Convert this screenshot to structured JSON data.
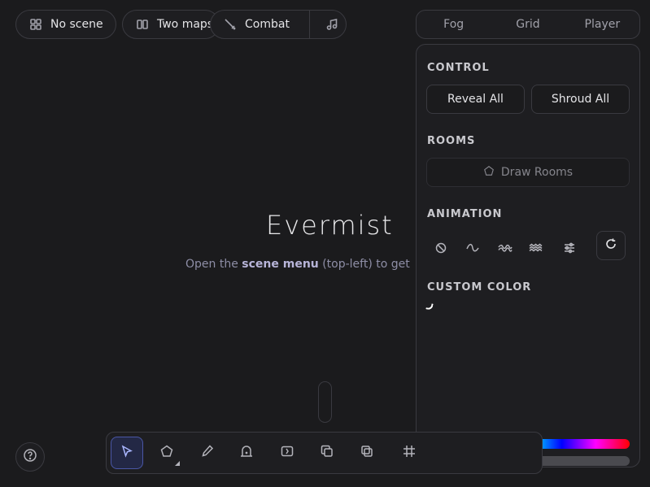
{
  "topbar": {
    "scene_label": "No scene",
    "maps_label": "Two maps",
    "combat_label": "Combat"
  },
  "tabs": [
    "Fog",
    "Grid",
    "Player"
  ],
  "panel": {
    "control_title": "CONTROL",
    "reveal_label": "Reveal All",
    "shroud_label": "Shroud All",
    "rooms_title": "ROOMS",
    "draw_rooms_label": "Draw Rooms",
    "animation_title": "ANIMATION",
    "custom_color_title": "CUSTOM COLOR"
  },
  "main": {
    "title": "Evermist",
    "subtitle_prefix": "Open the ",
    "subtitle_bold": "scene menu",
    "subtitle_suffix": " (top-left) to get"
  },
  "icons": {
    "scene": "grid-icon",
    "maps": "split-view-icon",
    "combat": "sword-off-icon",
    "music": "music-note-icon",
    "help": "help-circle-icon"
  },
  "colors": {
    "accent": "#4a57a6",
    "background": "#1b1b1d",
    "panel": "#1e1e21"
  }
}
